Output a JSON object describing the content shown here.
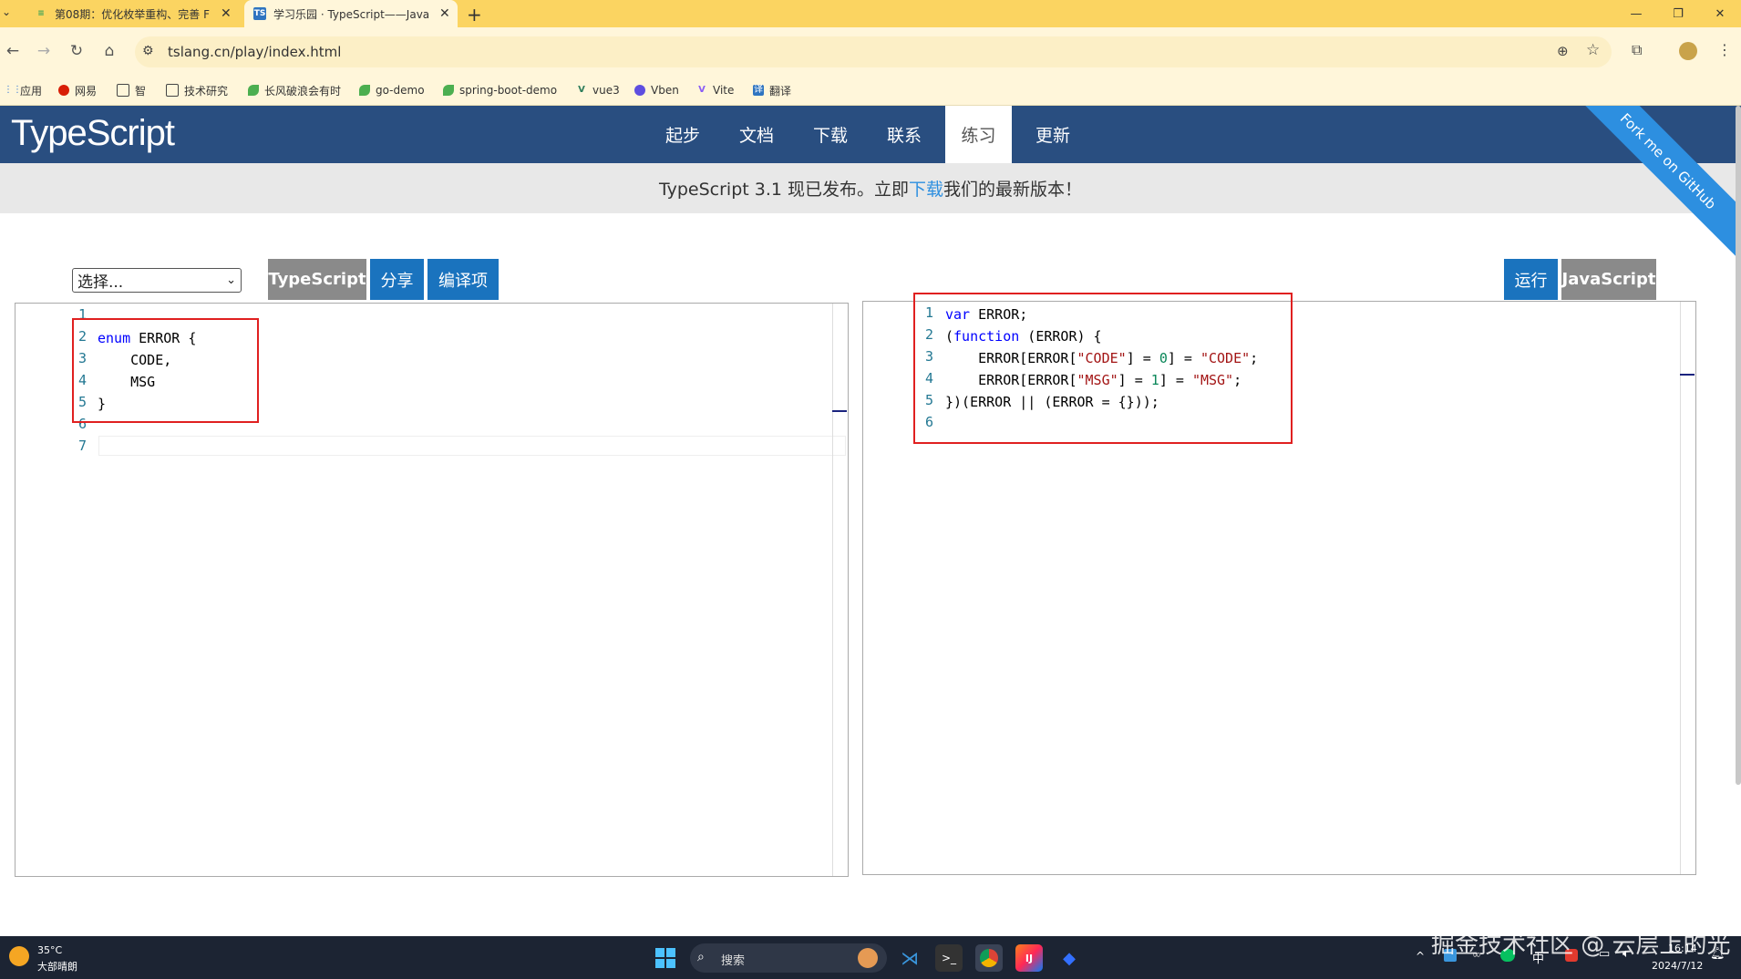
{
  "browser": {
    "tabs": [
      {
        "title": "第08期：优化枚举重构、完善 F",
        "active": false
      },
      {
        "title": "学习乐园 · TypeScript——Java",
        "active": true
      }
    ],
    "url": "tslang.cn/play/index.html",
    "bookmarks": [
      "应用",
      "网易",
      "智",
      "技术研究",
      "长风破浪会有时",
      "go-demo",
      "spring-boot-demo",
      "vue3",
      "Vben",
      "Vite",
      "翻译"
    ]
  },
  "site": {
    "logo": "TypeScript",
    "menu": [
      "起步",
      "文档",
      "下载",
      "联系",
      "练习",
      "更新"
    ],
    "active_menu": "练习",
    "ribbon": "Fork me on GitHub",
    "announcement": {
      "before": "TypeScript 3.1 现已发布。立即",
      "link": "下载",
      "after": "我们的最新版本！"
    }
  },
  "playground": {
    "select_value": "选择...",
    "buttons_left": [
      "TypeScript",
      "分享",
      "编译项"
    ],
    "buttons_right": [
      "运行",
      "JavaScript"
    ],
    "ts_line_numbers": [
      "1",
      "2",
      "3",
      "4",
      "5",
      "6",
      "7"
    ],
    "js_line_numbers": [
      "1",
      "2",
      "3",
      "4",
      "5",
      "6"
    ]
  },
  "taskbar": {
    "weather_temp": "35°C",
    "weather_desc": "大部晴朗",
    "search": "搜索",
    "ime": "中",
    "time": "16:14",
    "date": "2024/7/12"
  },
  "watermark": "掘金技术社区 @ 云层上的光",
  "colors": {
    "header": "#294e80",
    "accent": "#1a73be",
    "highlight_box": "#e02020",
    "tabbar": "#fbd461"
  }
}
